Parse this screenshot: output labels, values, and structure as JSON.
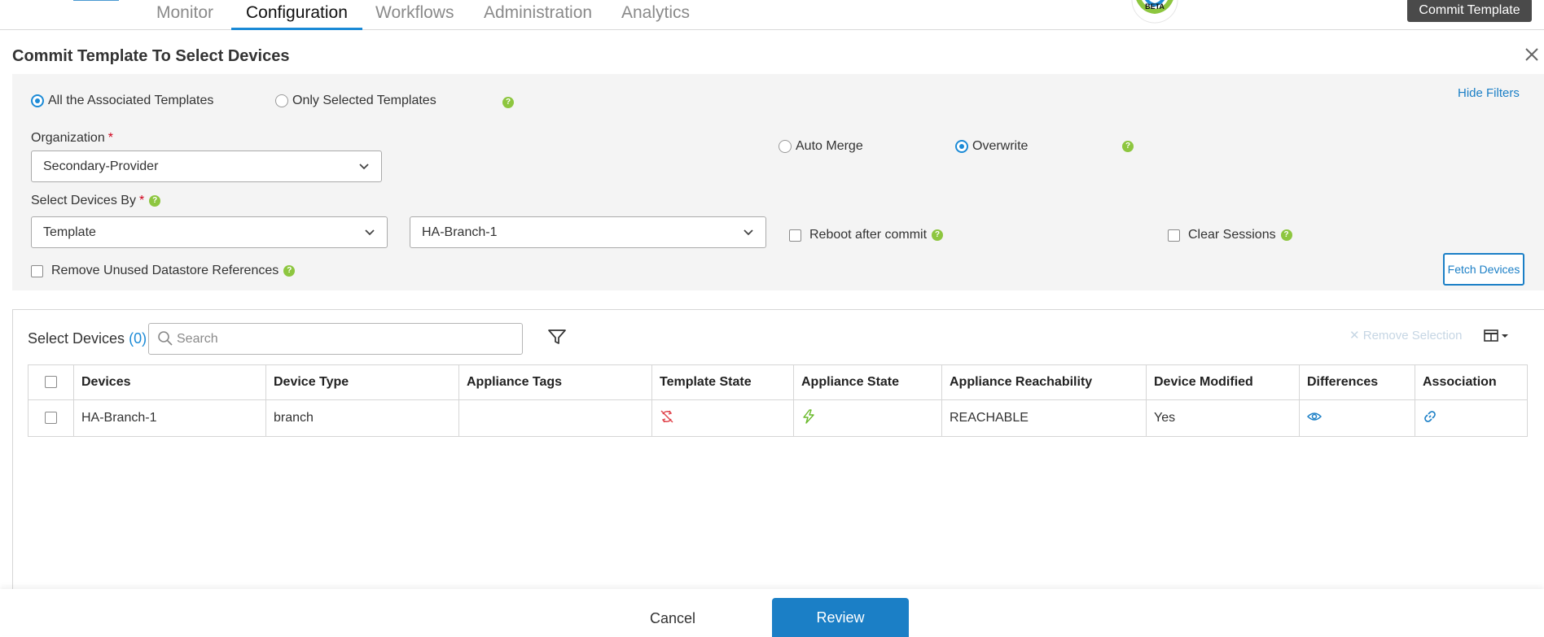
{
  "nav": {
    "tabs": [
      {
        "label": "Monitor"
      },
      {
        "label": "Configuration"
      },
      {
        "label": "Workflows"
      },
      {
        "label": "Administration"
      },
      {
        "label": "Analytics"
      }
    ],
    "active_tab": "Configuration",
    "beta_label": "BETA",
    "commit_template_label": "Commit Template"
  },
  "dialog": {
    "title": "Commit Template To Select Devices",
    "close_icon": "close-icon"
  },
  "filters": {
    "hide_filters_label": "Hide Filters",
    "template_scope": {
      "options": [
        "All the Associated Templates",
        "Only Selected Templates"
      ],
      "selected": "All the Associated Templates"
    },
    "organization": {
      "label": "Organization",
      "required_mark": "*",
      "value": "Secondary-Provider"
    },
    "merge_mode": {
      "options": [
        "Auto Merge",
        "Overwrite"
      ],
      "selected": "Overwrite"
    },
    "select_devices_by": {
      "label": "Select Devices By",
      "required_mark": "*",
      "value": "Template"
    },
    "template_value": "HA-Branch-1",
    "reboot_after_commit": {
      "label": "Reboot after commit",
      "checked": false
    },
    "clear_sessions": {
      "label": "Clear Sessions",
      "checked": false
    },
    "remove_unused_datastore": {
      "label": "Remove Unused Datastore References",
      "checked": false
    },
    "fetch_devices_label": "Fetch Devices",
    "help_glyph": "?"
  },
  "devices_panel": {
    "title": "Select Devices",
    "count": "(0)",
    "search_placeholder": "Search",
    "remove_selection_label": "Remove Selection",
    "columns": [
      "Devices",
      "Device Type",
      "Appliance Tags",
      "Template State",
      "Appliance State",
      "Appliance Reachability",
      "Device Modified",
      "Differences",
      "Association"
    ],
    "rows": [
      {
        "device": "HA-Branch-1",
        "device_type": "branch",
        "appliance_tags": "",
        "template_state_icon": "sync-disabled-icon",
        "appliance_state_icon": "lightning-icon",
        "reachability": "REACHABLE",
        "device_modified": "Yes",
        "differences_icon": "eye-icon",
        "association_icon": "link-icon"
      }
    ]
  },
  "footer": {
    "cancel_label": "Cancel",
    "review_label": "Review"
  },
  "colors": {
    "accent": "#1b8ad6",
    "help": "#8dc63f",
    "danger": "#d0021b",
    "commit_button": "#4a4a4a"
  }
}
